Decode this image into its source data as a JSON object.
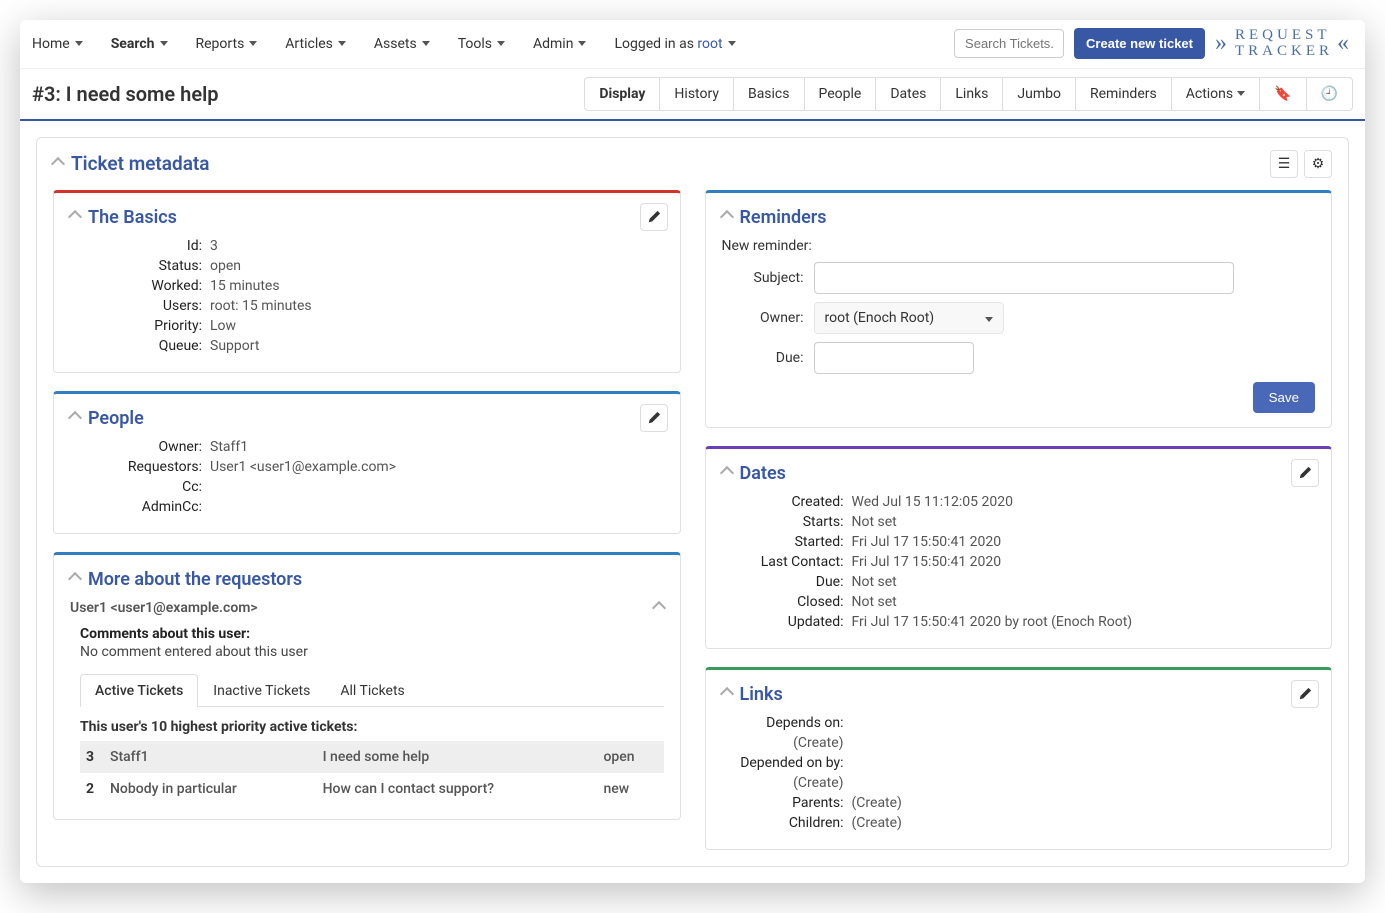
{
  "nav": {
    "items": [
      "Home",
      "Search",
      "Reports",
      "Articles",
      "Assets",
      "Tools",
      "Admin"
    ],
    "logged_in_prefix": "Logged in as ",
    "logged_in_user": "root",
    "search_placeholder": "Search Tickets...",
    "create_btn": "Create new ticket",
    "logo_top": "REQUEST",
    "logo_bottom": "TRACKER"
  },
  "page_title": "#3: I need some help",
  "pagetabs": [
    "Display",
    "History",
    "Basics",
    "People",
    "Dates",
    "Links",
    "Jumbo",
    "Reminders"
  ],
  "actions_label": "Actions",
  "meta_title": "Ticket metadata",
  "basics": {
    "title": "The Basics",
    "rows": [
      {
        "k": "Id:",
        "v": "3"
      },
      {
        "k": "Status:",
        "v": "open"
      },
      {
        "k": "Worked:",
        "v": "15 minutes"
      },
      {
        "k": "Users:",
        "v": "root: 15 minutes"
      },
      {
        "k": "Priority:",
        "v": "Low"
      },
      {
        "k": "Queue:",
        "v": "Support"
      }
    ]
  },
  "people": {
    "title": "People",
    "rows": [
      {
        "k": "Owner:",
        "v": "Staff1"
      },
      {
        "k": "Requestors:",
        "v": "User1 <user1@example.com>"
      },
      {
        "k": "Cc:",
        "v": ""
      },
      {
        "k": "AdminCc:",
        "v": ""
      }
    ]
  },
  "requestors": {
    "title": "More about the requestors",
    "user": "User1 <user1@example.com>",
    "comments_label": "Comments about this user:",
    "comments_text": "No comment entered about this user",
    "tabs": [
      "Active Tickets",
      "Inactive Tickets",
      "All Tickets"
    ],
    "table_title": "This user's 10 highest priority active tickets:",
    "rows": [
      {
        "id": "3",
        "owner": "Staff1",
        "subject": "I need some help",
        "status": "open"
      },
      {
        "id": "2",
        "owner": "Nobody in particular",
        "subject": "How can I contact support?",
        "status": "new"
      }
    ]
  },
  "reminders": {
    "title": "Reminders",
    "new_label": "New reminder:",
    "subject_lbl": "Subject:",
    "owner_lbl": "Owner:",
    "owner_val": "root (Enoch Root)",
    "due_lbl": "Due:",
    "save": "Save"
  },
  "dates": {
    "title": "Dates",
    "rows": [
      {
        "k": "Created:",
        "v": "Wed Jul 15 11:12:05 2020"
      },
      {
        "k": "Starts:",
        "v": "Not set"
      },
      {
        "k": "Started:",
        "v": "Fri Jul 17 15:50:41 2020"
      },
      {
        "k": "Last Contact:",
        "v": "Fri Jul 17 15:50:41 2020"
      },
      {
        "k": "Due:",
        "v": "Not set"
      },
      {
        "k": "Closed:",
        "v": "Not set"
      },
      {
        "k": "Updated:",
        "v": "Fri Jul 17 15:50:41 2020 by root (Enoch Root)"
      }
    ]
  },
  "links": {
    "title": "Links",
    "rows": [
      {
        "k": "Depends on:",
        "create": "(Create)",
        "twoline": true
      },
      {
        "k": "Depended on by:",
        "create": "(Create)",
        "twoline": true
      },
      {
        "k": "Parents:",
        "create": "(Create)",
        "twoline": false
      },
      {
        "k": "Children:",
        "create": "(Create)",
        "twoline": false
      }
    ]
  }
}
